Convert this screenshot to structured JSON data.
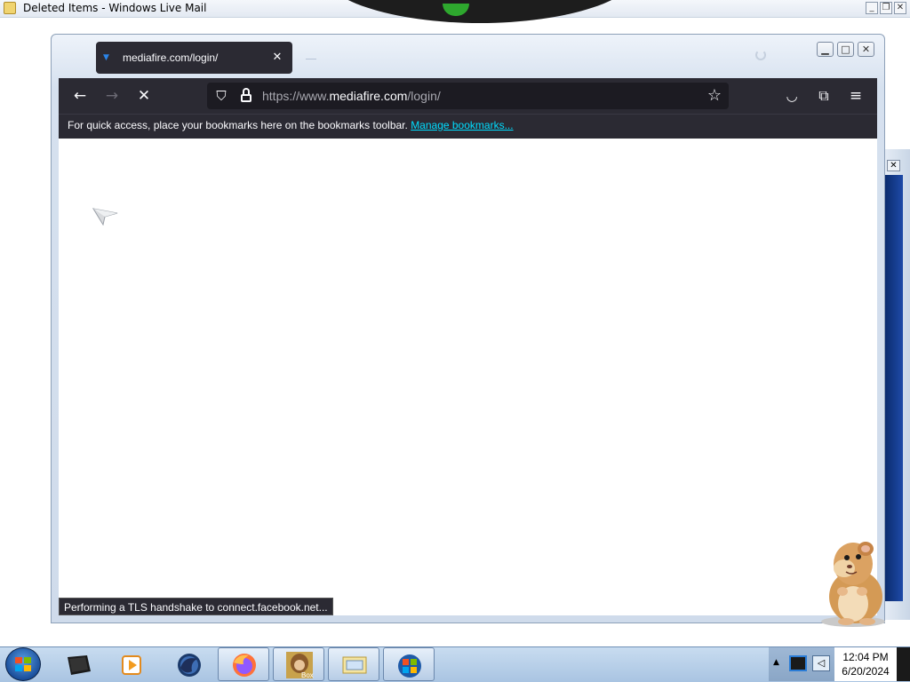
{
  "background_window": {
    "title": "Deleted Items - Windows Live Mail",
    "controls": [
      "minimize-icon",
      "restore-icon",
      "close-icon"
    ]
  },
  "browser": {
    "tab": {
      "title": "mediafire.com/login/"
    },
    "url": {
      "prefix": "https://www.",
      "host": "mediafire.com",
      "path": "/login/"
    },
    "bookmarks_bar": {
      "message": "For quick access, place your bookmarks here on the bookmarks toolbar. ",
      "link": "Manage bookmarks..."
    },
    "status_text": "Performing a TLS handshake to connect.facebook.net...",
    "icons": {
      "back": "back-arrow-icon",
      "forward": "forward-arrow-icon",
      "stop": "stop-loading-icon",
      "shield": "tracking-protection-shield-icon",
      "lock": "lock-icon",
      "star": "bookmark-star-icon",
      "pocket": "pocket-icon",
      "extensions": "extensions-puzzle-icon",
      "menu": "hamburger-menu-icon"
    },
    "colors": {
      "toolbar": "#2b2a33",
      "urlbar": "#1c1b22",
      "link": "#00ddff"
    }
  },
  "taskbar": {
    "items": [
      "terminal",
      "media-player",
      "firefox-old",
      "firefox",
      "bonzi-box",
      "mail",
      "windows"
    ],
    "clock": {
      "time": "12:04 PM",
      "date": "6/20/2024"
    }
  }
}
